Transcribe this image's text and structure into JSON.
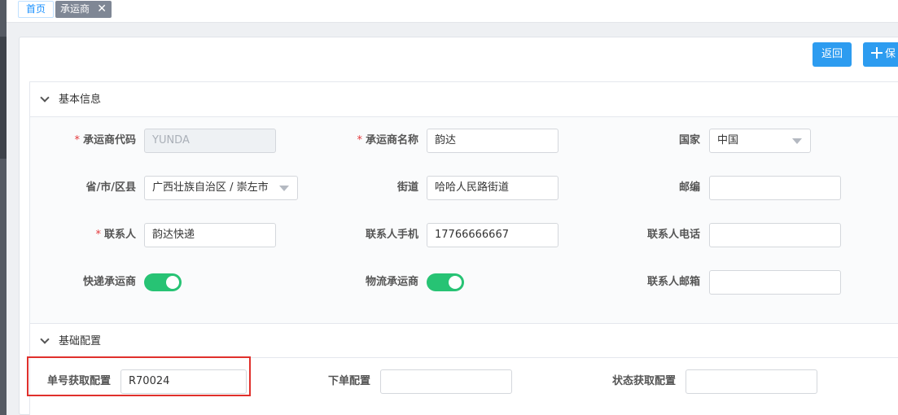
{
  "tabs": {
    "home": "首页",
    "carrier": "承运商",
    "close": "✕"
  },
  "toolbar": {
    "back_label": "返回",
    "save_label": "保"
  },
  "basic_info": {
    "title": "基本信息",
    "carrier_code": {
      "label": "承运商代码",
      "value": "YUNDA"
    },
    "carrier_name": {
      "label": "承运商名称",
      "value": "韵达"
    },
    "country": {
      "label": "国家",
      "value": "中国"
    },
    "region": {
      "label": "省/市/区县",
      "value": "广西壮族自治区 / 崇左市"
    },
    "street": {
      "label": "街道",
      "value": "哈哈人民路街道"
    },
    "postcode": {
      "label": "邮编",
      "value": ""
    },
    "contact": {
      "label": "联系人",
      "value": "韵达快递"
    },
    "contact_mobile": {
      "label": "联系人手机",
      "value": "17766666667"
    },
    "contact_phone": {
      "label": "联系人电话",
      "value": ""
    },
    "express_carrier": {
      "label": "快递承运商",
      "on": true
    },
    "logistics_carrier": {
      "label": "物流承运商",
      "on": true
    },
    "contact_email": {
      "label": "联系人邮箱",
      "value": ""
    }
  },
  "basic_config": {
    "title": "基础配置",
    "tracking_config": {
      "label": "单号获取配置",
      "value": "R70024"
    },
    "order_config": {
      "label": "下单配置",
      "value": ""
    },
    "status_config": {
      "label": "状态获取配置",
      "value": ""
    }
  },
  "colors": {
    "accent": "#2d9cf0",
    "toggle_on": "#27c374",
    "highlight": "#e0302c",
    "required": "#e4393c"
  }
}
